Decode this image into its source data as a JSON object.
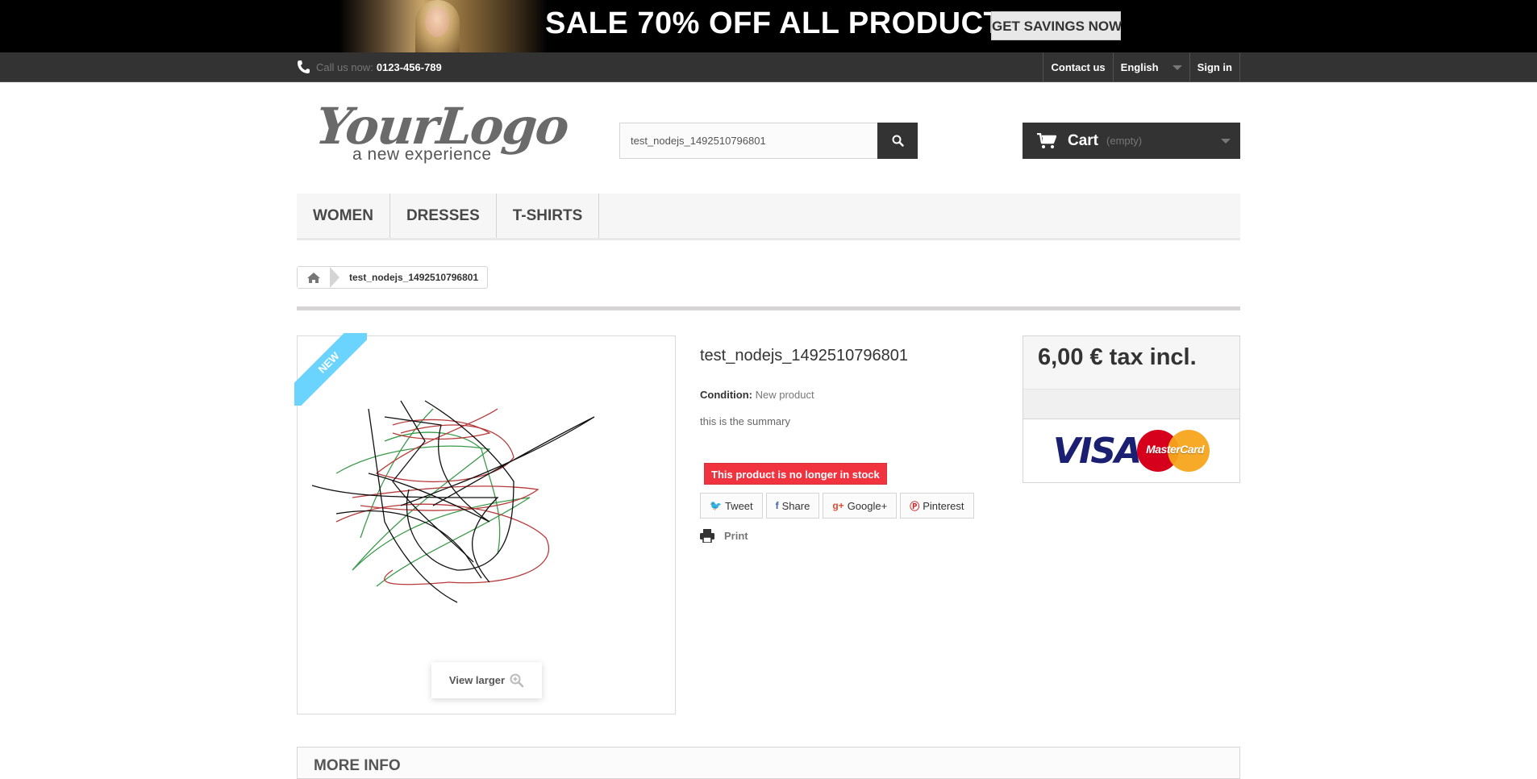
{
  "banner": {
    "headline": "SALE 70% OFF ALL PRODUCTS",
    "button_label": "GET SAVINGS NOW"
  },
  "topbar": {
    "call_label": "Call us now:",
    "phone": "0123-456-789",
    "contact_label": "Contact us",
    "language": "English",
    "signin_label": "Sign in"
  },
  "header": {
    "logo_main": "YourLogo",
    "logo_sub": "a new experience",
    "search_value": "test_nodejs_1492510796801",
    "cart_label": "Cart",
    "cart_status": "(empty)"
  },
  "menu": {
    "items": [
      {
        "label": "Women"
      },
      {
        "label": "Dresses"
      },
      {
        "label": "T-shirts"
      }
    ]
  },
  "breadcrumb": {
    "current": "test_nodejs_1492510796801"
  },
  "product": {
    "badge": "New",
    "view_larger": "View larger",
    "name": "test_nodejs_1492510796801",
    "condition_label": "Condition:",
    "condition_value": "New product",
    "summary": "this is the summary",
    "stock_message": "This product is no longer in stock",
    "social": {
      "tweet": "Tweet",
      "share": "Share",
      "googleplus": "Google+",
      "pinterest": "Pinterest"
    },
    "print_label": "Print"
  },
  "price_box": {
    "price": "6,00 € tax incl.",
    "cards": {
      "visa": "VISA",
      "mastercard": "MasterCard"
    }
  },
  "more_info": {
    "title": "More info"
  },
  "colors": {
    "banner_bg": "#000000",
    "topbar_bg": "#333333",
    "stock_alert": "#f13340",
    "ribbon": "#6ad4ff",
    "sketch_black": "#111111",
    "sketch_red": "#b83a3a",
    "sketch_green": "#3a9a4a"
  }
}
